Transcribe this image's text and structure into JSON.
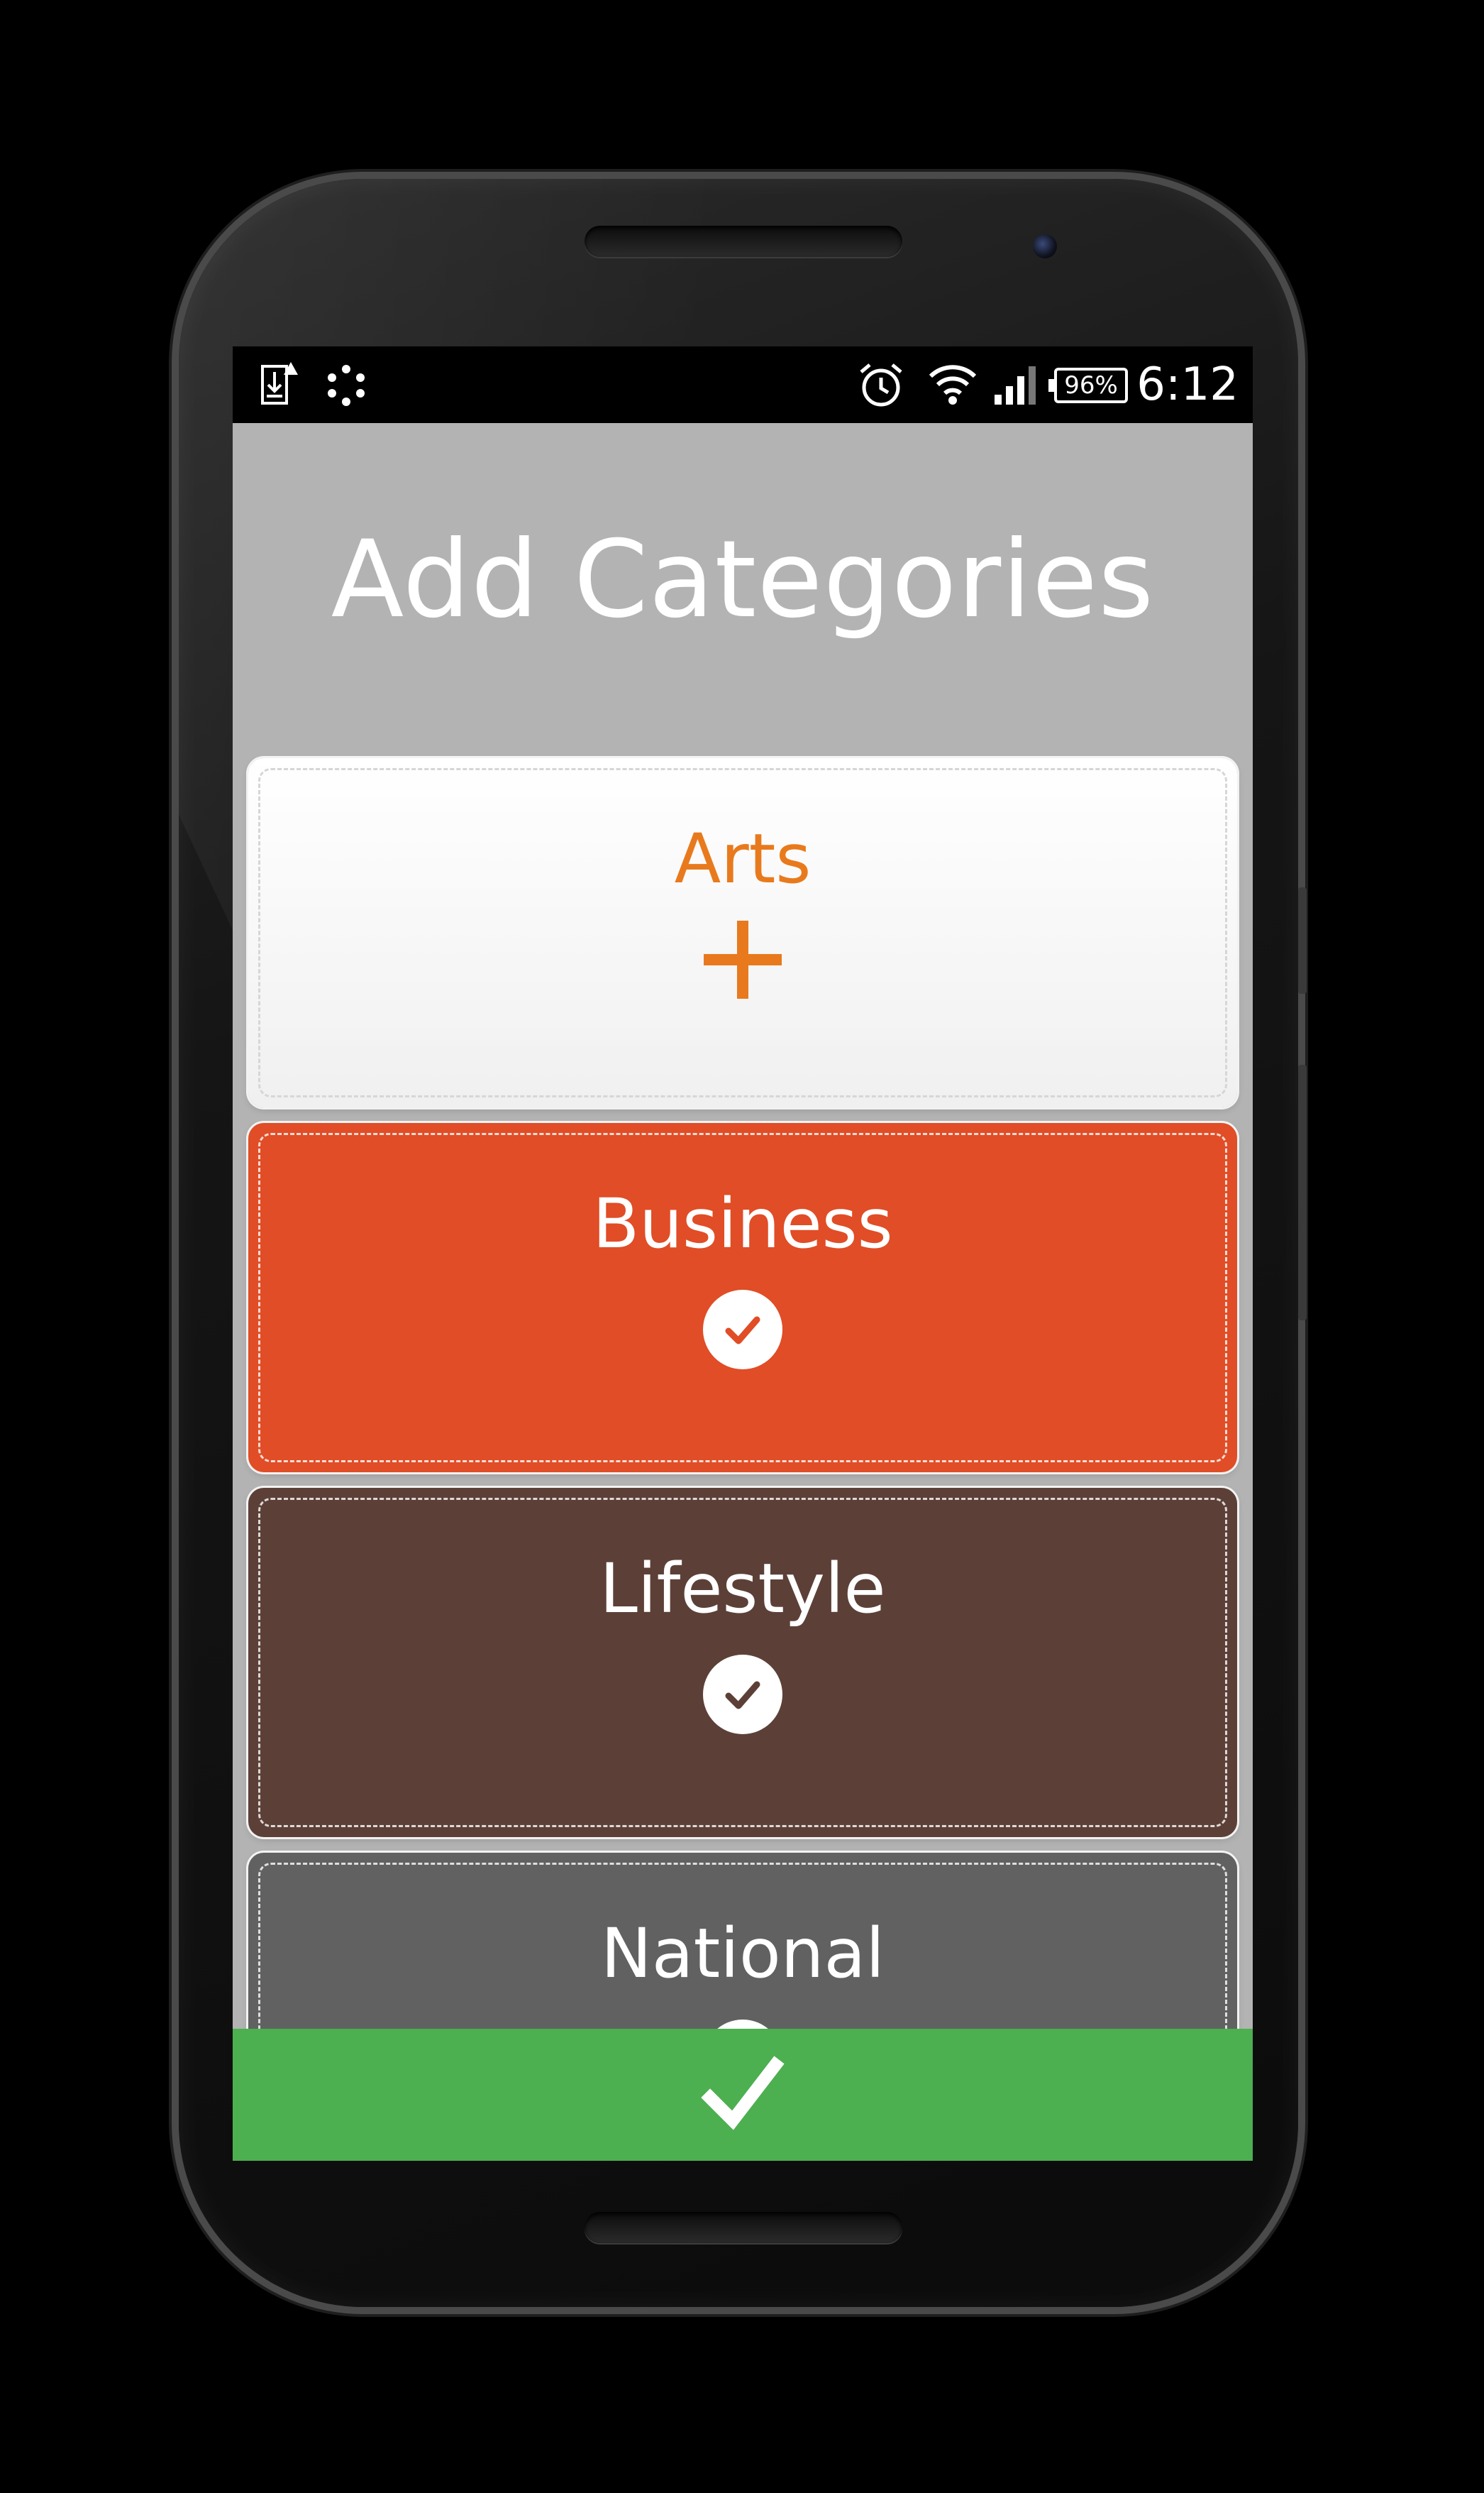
{
  "status_bar": {
    "left_icons": [
      "download-alert-icon",
      "loading-dots-icon"
    ],
    "right_icons": [
      "alarm-icon",
      "wifi-icon",
      "signal-icon"
    ],
    "battery_percent": "96%",
    "time": "6:12"
  },
  "header": {
    "title": "Add Categories"
  },
  "categories": [
    {
      "label": "Arts",
      "state": "add",
      "icon": "plus-icon",
      "color": "#ffffff",
      "accent": "#e87a1d"
    },
    {
      "label": "Business",
      "state": "selected",
      "icon": "check-circle-icon",
      "color": "#e04d26"
    },
    {
      "label": "Lifestyle",
      "state": "selected",
      "icon": "check-circle-icon",
      "color": "#5c4037"
    },
    {
      "label": "National",
      "state": "selected",
      "icon": "check-circle-icon",
      "color": "#616161"
    }
  ],
  "confirm_button": {
    "icon": "checkmark-icon",
    "color": "#4caf50"
  }
}
